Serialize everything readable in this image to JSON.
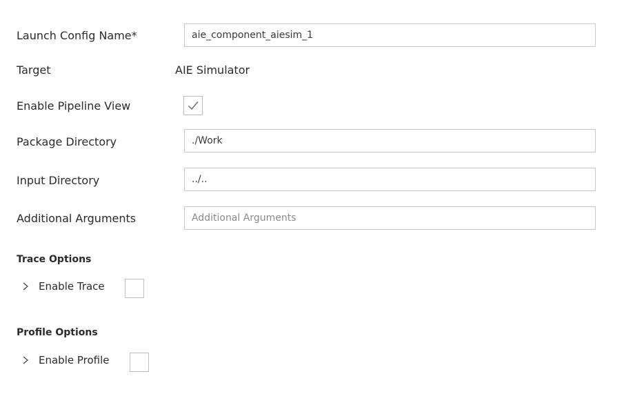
{
  "form": {
    "launch_config": {
      "label": "Launch Config Name*",
      "value": "aie_component_aiesim_1"
    },
    "target": {
      "label": "Target",
      "value": "AIE Simulator"
    },
    "pipeline_view": {
      "label": "Enable Pipeline View",
      "checked": true
    },
    "package_dir": {
      "label": "Package Directory",
      "value": "./Work"
    },
    "input_dir": {
      "label": "Input Directory",
      "value": "../.."
    },
    "additional_args": {
      "label": "Additional Arguments",
      "value": "",
      "placeholder": "Additional Arguments"
    }
  },
  "trace": {
    "title": "Trace Options",
    "enable_label": "Enable Trace",
    "checked": false
  },
  "profile": {
    "title": "Profile Options",
    "enable_label": "Enable Profile",
    "checked": false
  },
  "icons": {
    "check": "check-icon",
    "chevron": "chevron-right-icon"
  }
}
